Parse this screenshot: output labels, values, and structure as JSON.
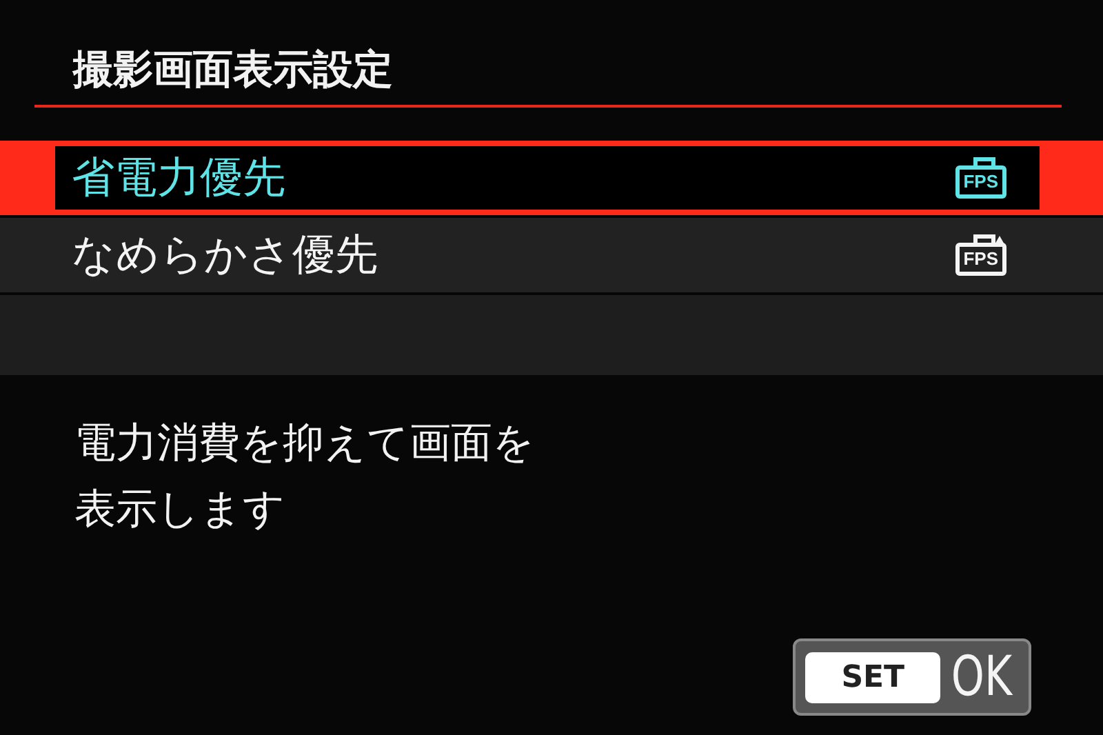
{
  "title": "撮影画面表示設定",
  "options": [
    {
      "label": "省電力優先",
      "selected": true,
      "kind": "standard",
      "icon_label": "FPS"
    },
    {
      "label": "なめらかさ優先",
      "selected": false,
      "kind": "boost",
      "icon_label": "FPS"
    }
  ],
  "description": [
    "電力消費を抑えて画面を",
    "表示します"
  ],
  "set_button": {
    "key": "SET",
    "label": "OK"
  }
}
